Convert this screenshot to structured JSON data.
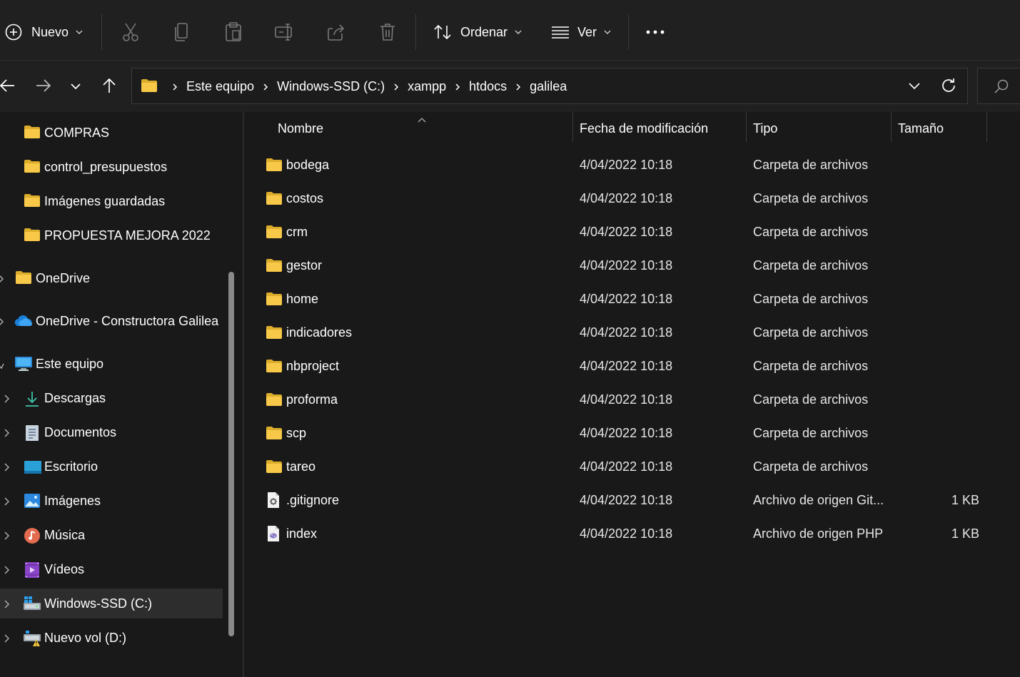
{
  "toolbar": {
    "new_label": "Nuevo",
    "sort_label": "Ordenar",
    "view_label": "Ver"
  },
  "address": {
    "breadcrumbs": [
      "Este equipo",
      "Windows-SSD (C:)",
      "xampp",
      "htdocs",
      "galilea"
    ]
  },
  "sidebar": {
    "items": [
      {
        "label": "COMPRAS",
        "icon": "folder-icon"
      },
      {
        "label": "control_presupuestos",
        "icon": "folder-icon"
      },
      {
        "label": "Imágenes guardadas",
        "icon": "folder-icon"
      },
      {
        "label": "PROPUESTA MEJORA 2022",
        "icon": "folder-icon"
      },
      {
        "label": "OneDrive",
        "icon": "folder-icon"
      },
      {
        "label": "OneDrive - Constructora Galilea",
        "icon": "onedrive-cloud-icon"
      },
      {
        "label": "Este equipo",
        "icon": "computer-icon"
      },
      {
        "label": "Descargas",
        "icon": "download-icon"
      },
      {
        "label": "Documentos",
        "icon": "document-icon"
      },
      {
        "label": "Escritorio",
        "icon": "desktop-icon"
      },
      {
        "label": "Imágenes",
        "icon": "pictures-icon"
      },
      {
        "label": "Música",
        "icon": "music-icon"
      },
      {
        "label": "Vídeos",
        "icon": "videos-icon"
      },
      {
        "label": "Windows-SSD (C:)",
        "icon": "windows-drive-icon"
      },
      {
        "label": "Nuevo vol (D:)",
        "icon": "drive-warning-icon"
      }
    ]
  },
  "list": {
    "headers": {
      "name": "Nombre",
      "modified": "Fecha de modificación",
      "type": "Tipo",
      "size": "Tamaño"
    },
    "rows": [
      {
        "name": "bodega",
        "modified": "4/04/2022 10:18",
        "type": "Carpeta de archivos",
        "size": "",
        "icon": "folder-icon"
      },
      {
        "name": "costos",
        "modified": "4/04/2022 10:18",
        "type": "Carpeta de archivos",
        "size": "",
        "icon": "folder-icon"
      },
      {
        "name": "crm",
        "modified": "4/04/2022 10:18",
        "type": "Carpeta de archivos",
        "size": "",
        "icon": "folder-icon"
      },
      {
        "name": "gestor",
        "modified": "4/04/2022 10:18",
        "type": "Carpeta de archivos",
        "size": "",
        "icon": "folder-icon"
      },
      {
        "name": "home",
        "modified": "4/04/2022 10:18",
        "type": "Carpeta de archivos",
        "size": "",
        "icon": "folder-icon"
      },
      {
        "name": "indicadores",
        "modified": "4/04/2022 10:18",
        "type": "Carpeta de archivos",
        "size": "",
        "icon": "folder-icon"
      },
      {
        "name": "nbproject",
        "modified": "4/04/2022 10:18",
        "type": "Carpeta de archivos",
        "size": "",
        "icon": "folder-icon"
      },
      {
        "name": "proforma",
        "modified": "4/04/2022 10:18",
        "type": "Carpeta de archivos",
        "size": "",
        "icon": "folder-icon"
      },
      {
        "name": "scp",
        "modified": "4/04/2022 10:18",
        "type": "Carpeta de archivos",
        "size": "",
        "icon": "folder-icon"
      },
      {
        "name": "tareo",
        "modified": "4/04/2022 10:18",
        "type": "Carpeta de archivos",
        "size": "",
        "icon": "folder-icon"
      },
      {
        "name": ".gitignore",
        "modified": "4/04/2022 10:18",
        "type": "Archivo de origen Git...",
        "size": "1 KB",
        "icon": "config-file-icon"
      },
      {
        "name": "index",
        "modified": "4/04/2022 10:18",
        "type": "Archivo de origen PHP",
        "size": "1 KB",
        "icon": "php-file-icon"
      }
    ]
  },
  "colors": {
    "window_bg": "#191919",
    "toolbar_bg": "#202020",
    "folder_yellow": "#f8c948",
    "selected_bg": "#2d2d2d",
    "accent_blue": "#60cdff"
  }
}
